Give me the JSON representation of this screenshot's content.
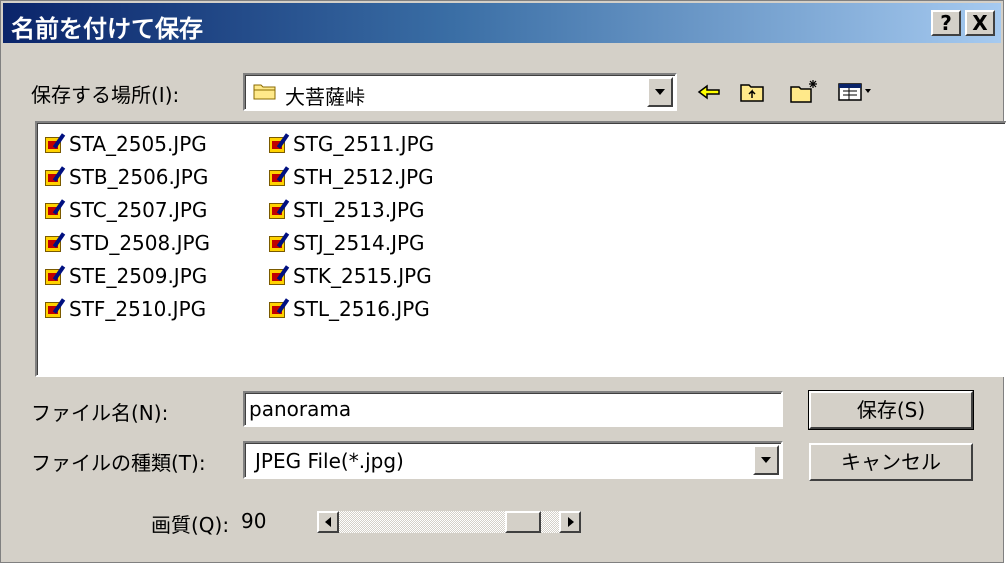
{
  "window": {
    "title": "名前を付けて保存",
    "help_label": "?",
    "close_label": "X"
  },
  "location": {
    "label": "保存する場所(I):",
    "folder": "大菩薩峠"
  },
  "toolbar": {
    "back_icon": "back-arrow-icon",
    "up_icon": "up-folder-icon",
    "new_folder_icon": "new-folder-icon",
    "view_icon": "view-menu-icon"
  },
  "files": {
    "column1": [
      "STA_2505.JPG",
      "STB_2506.JPG",
      "STC_2507.JPG",
      "STD_2508.JPG",
      "STE_2509.JPG",
      "STF_2510.JPG"
    ],
    "column2": [
      "STG_2511.JPG",
      "STH_2512.JPG",
      "STI_2513.JPG",
      "STJ_2514.JPG",
      "STK_2515.JPG",
      "STL_2516.JPG"
    ]
  },
  "filename": {
    "label": "ファイル名(N):",
    "value": "panorama"
  },
  "filetype": {
    "label": "ファイルの種類(T):",
    "value": "JPEG File(*.jpg)"
  },
  "quality": {
    "label": "画質(Q):",
    "value": "90",
    "fraction": 0.9
  },
  "buttons": {
    "save": "保存(S)",
    "cancel": "キャンセル"
  },
  "colors": {
    "title_gradient_start": "#0a246a",
    "title_gradient_end": "#a6caf0",
    "face": "#d4d0c8"
  }
}
